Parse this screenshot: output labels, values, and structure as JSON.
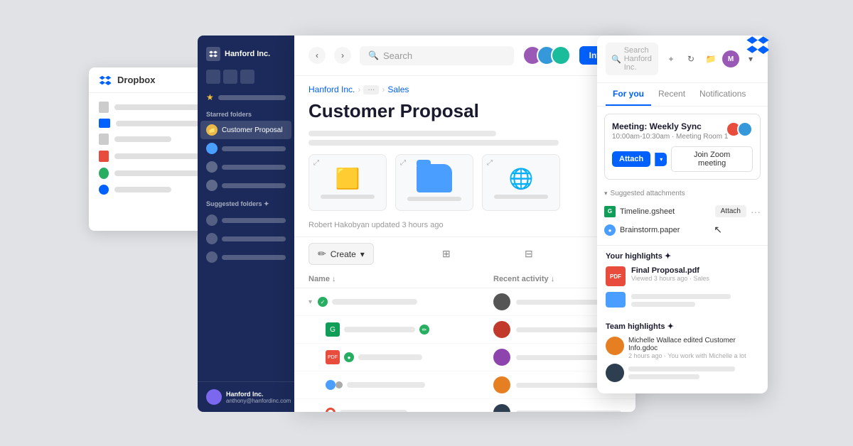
{
  "app": {
    "title": "Dropbox",
    "bg_color": "#e0e2e6"
  },
  "sidebar": {
    "company": "Hanford Inc.",
    "starred_label": "Starred folders",
    "suggested_label": "Suggested folders ✦",
    "active_folder": "Customer Proposal",
    "footer": {
      "name": "Hanford Inc.",
      "email": "anthony@hanfordinc.com"
    }
  },
  "header": {
    "search_placeholder": "Search",
    "invite_label": "Invite"
  },
  "breadcrumb": {
    "root": "Hanford Inc.",
    "dots": "···",
    "current": "Sales"
  },
  "content": {
    "title": "Customer Proposal",
    "updated_text": "Robert Hakobyan updated 3 hours ago",
    "create_label": "Create",
    "columns": {
      "name": "Name ↓",
      "activity": "Recent activity ↓"
    }
  },
  "right_panel": {
    "search_placeholder": "Search Hanford Inc.",
    "tabs": [
      "For you",
      "Recent",
      "Notifications"
    ],
    "active_tab": "For you",
    "meeting": {
      "title": "Meeting: Weekly Sync",
      "time": "10:00am-10:30am · Meeting Room 1",
      "attach_label": "Attach",
      "join_zoom_label": "Join Zoom meeting"
    },
    "suggested_attachments": {
      "label": "Suggested attachments",
      "files": [
        {
          "name": "Timeline.gsheet",
          "type": "sheets"
        },
        {
          "name": "Brainstorm.paper",
          "type": "paper"
        }
      ],
      "attach_label": "Attach"
    },
    "highlights": {
      "title": "Your highlights ✦",
      "items": [
        {
          "name": "Final Proposal.pdf",
          "meta": "Viewed 3 hours ago · Sales",
          "type": "pdf"
        },
        {
          "name": "",
          "meta": "",
          "type": "folder"
        }
      ]
    },
    "team_highlights": {
      "title": "Team highlights ✦",
      "items": [
        {
          "action": "Michelle Wallace edited Customer Info.gdoc",
          "meta": "2 hours ago · You work with Michelle a lot",
          "avatar_type": "ta1"
        },
        {
          "action": "",
          "meta": "",
          "avatar_type": "ta2"
        }
      ]
    }
  }
}
